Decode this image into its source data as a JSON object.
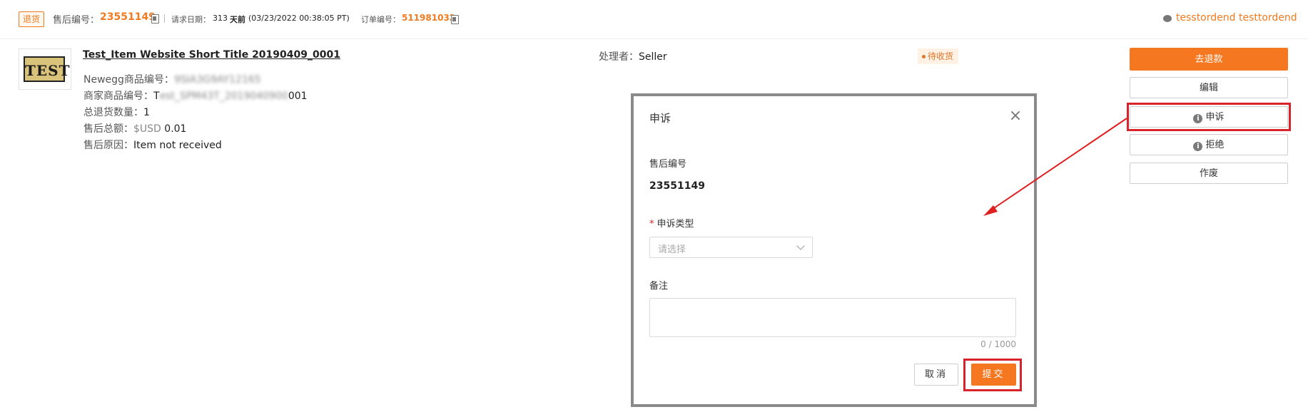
{
  "header": {
    "return_tag": "退货",
    "after_sale_no_label": "售后编号：",
    "after_sale_no": "23551149",
    "request_date_label": "请求日期：",
    "request_days": "313",
    "request_days_suffix": "天前",
    "request_date_detail": "(03/23/2022 00:38:05 PT)",
    "order_no_label": "订单编号：",
    "order_no": "511981032",
    "user_name": "tesstordend testtordend"
  },
  "item": {
    "thumb_text": "TEST",
    "title": "Test_Item Website Short Title 20190409_0001",
    "newegg_no_label": "Newegg商品编号：",
    "newegg_no": "9SIA3G9AY12165",
    "seller_no_label": "商家商品编号：",
    "seller_no_prefix": "T",
    "seller_no_blur": "est_SPM43T_2019040900",
    "seller_no_suffix": "001",
    "total_qty_label": "总退货数量：",
    "total_qty": "1",
    "total_amount_label": "售后总额：",
    "currency": "$USD",
    "total_amount": "0.01",
    "reason_label": "售后原因：",
    "reason": "Item not received",
    "handler_label": "处理者：",
    "handler": "Seller",
    "status": "待收货"
  },
  "actions": {
    "refund": "去退款",
    "edit": "编辑",
    "appeal": "申诉",
    "reject": "拒绝",
    "void": "作废"
  },
  "modal": {
    "title": "申诉",
    "after_sale_no_label": "售后编号",
    "after_sale_no": "23551149",
    "appeal_type_label": "申诉类型",
    "required_mark": "*",
    "select_placeholder": "请选择",
    "remark_label": "备注",
    "counter": "0 / 1000",
    "cancel": "取消",
    "submit": "提交"
  },
  "colors": {
    "accent": "#f5771f",
    "highlight": "#d8232a"
  }
}
